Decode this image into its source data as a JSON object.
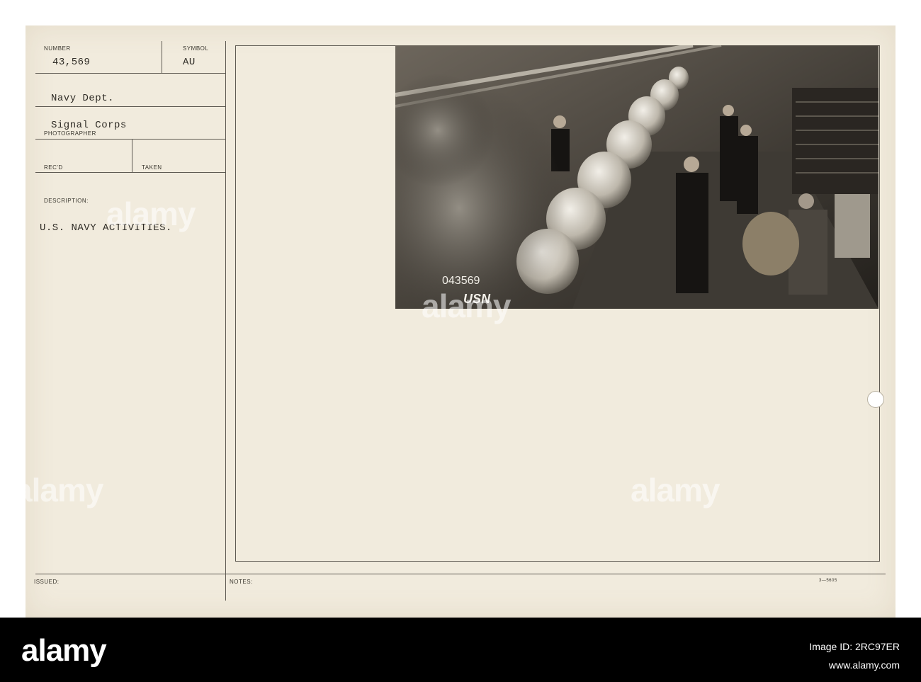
{
  "card": {
    "labels": {
      "number": "NUMBER",
      "symbol": "SYMBOL",
      "photographer": "PHOTOGRAPHER",
      "recd": "REC'D",
      "taken": "TAKEN",
      "description": "DESCRIPTION:",
      "issued": "ISSUED:",
      "notes": "NOTES:"
    },
    "values": {
      "number": "43,569",
      "symbol": "AU",
      "dept": "Navy Dept.",
      "photographer": "Signal Corps",
      "description": "U.S. NAVY ACTIVITIES.",
      "form_code": "3—5605"
    },
    "photo": {
      "negative_number": "043569",
      "negative_mark": "USN"
    }
  },
  "watermark": "alamy",
  "footer": {
    "logo": "alamy",
    "image_id_line": "Image ID: 2RC97ER",
    "url": "www.alamy.com"
  },
  "colors": {
    "card_bg": "#f1ebdd",
    "ink": "#2f2c26",
    "footer_bg": "#000000"
  }
}
